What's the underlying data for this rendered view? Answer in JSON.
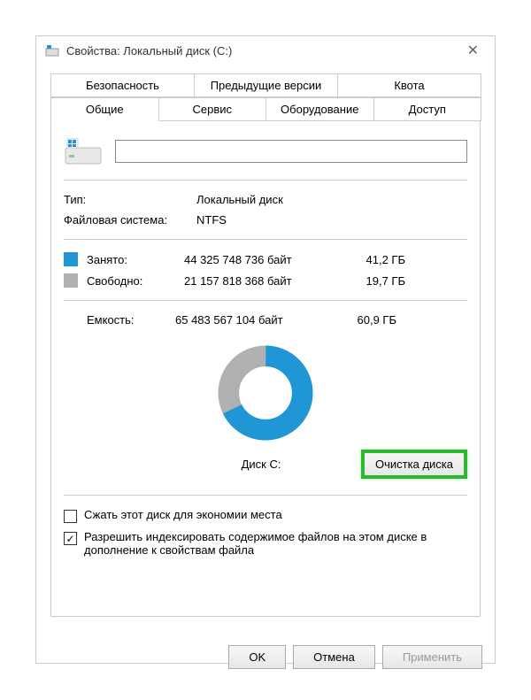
{
  "titlebar": {
    "title": "Свойства: Локальный диск (C:)"
  },
  "tabs": {
    "row1": [
      "Безопасность",
      "Предыдущие версии",
      "Квота"
    ],
    "row2": [
      "Общие",
      "Сервис",
      "Оборудование",
      "Доступ"
    ],
    "active": "Общие"
  },
  "name_field": {
    "value": ""
  },
  "type": {
    "label": "Тип:",
    "value": "Локальный диск"
  },
  "filesystem": {
    "label": "Файловая система:",
    "value": "NTFS"
  },
  "used": {
    "label": "Занято:",
    "bytes": "44 325 748 736 байт",
    "gb": "41,2 ГБ"
  },
  "free": {
    "label": "Свободно:",
    "bytes": "21 157 818 368 байт",
    "gb": "19,7 ГБ"
  },
  "capacity": {
    "label": "Емкость:",
    "bytes": "65 483 567 104 байт",
    "gb": "60,9 ГБ"
  },
  "disk_label": "Диск C:",
  "cleanup_button": "Очистка диска",
  "compress_checkbox": "Сжать этот диск для экономии места",
  "index_checkbox": "Разрешить индексировать содержимое файлов на этом диске в дополнение к свойствам файла",
  "buttons": {
    "ok": "OK",
    "cancel": "Отмена",
    "apply": "Применить"
  },
  "chart_data": {
    "type": "pie",
    "title": "Диск C:",
    "series": [
      {
        "name": "Занято",
        "value": 44325748736,
        "value_gb": 41.2,
        "color": "#2196d6"
      },
      {
        "name": "Свободно",
        "value": 21157818368,
        "value_gb": 19.7,
        "color": "#b0b0b0"
      }
    ],
    "total": 65483567104,
    "total_gb": 60.9
  }
}
